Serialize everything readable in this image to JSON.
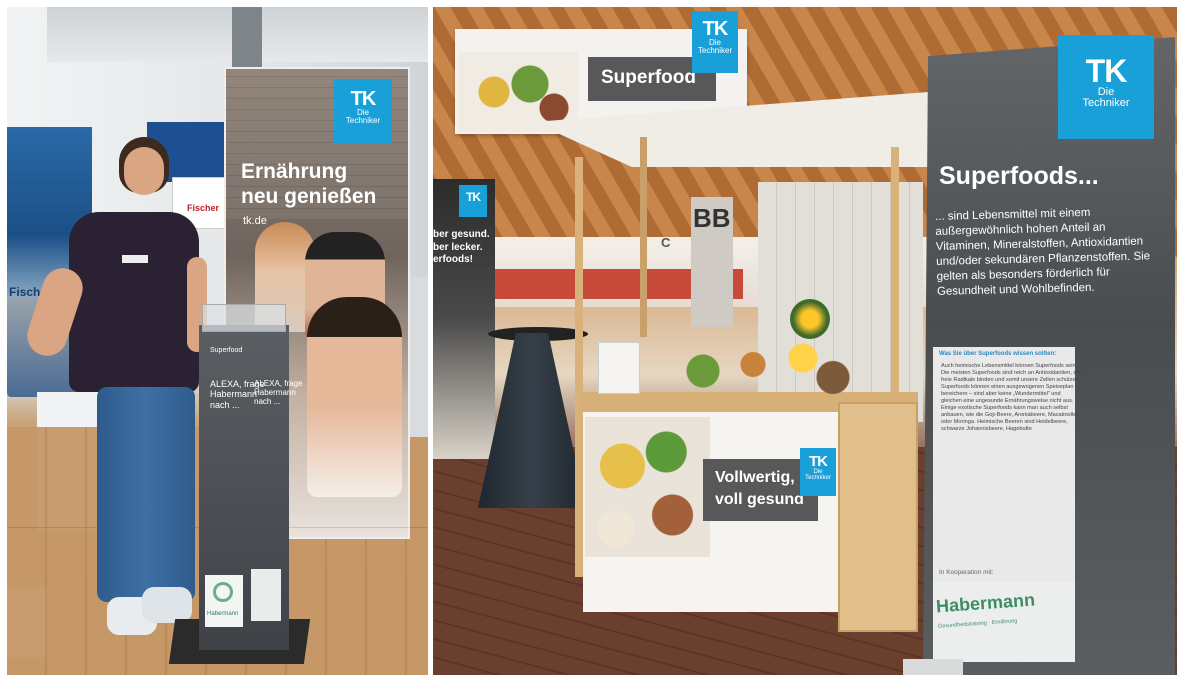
{
  "left_photo": {
    "main_banner": {
      "headline_line1": "Ernährung",
      "headline_line2": "neu genießen",
      "url": "tk.de"
    },
    "tk_logo": {
      "letters": "TK",
      "line1": "Die",
      "line2": "Techniker"
    },
    "side_sign": {
      "text": "Fischer"
    },
    "left_text": {
      "text": "Fisch"
    },
    "pillar": {
      "brand": "Superfood",
      "question": "ALEXA, frage\nHabermann\nnach ...",
      "question_side": "ALEXA, frage\nHabermann\nnach ...",
      "bottom_logo": "Habermann"
    }
  },
  "right_photo": {
    "booth_header": {
      "title": "Superfood"
    },
    "small_banner": {
      "text": "ber gesund.\nber lecker.\nerfoods!"
    },
    "wall_letters": "BB",
    "wall_letter_c": "C",
    "counter_banner": {
      "line1": "Vollwertig,",
      "line2": "voll gesund"
    },
    "rollup": {
      "title": "Superfoods...",
      "body": "... sind Lebensmittel mit einem außergewöhnlich hohen Anteil an Vitaminen, Mineralstoffen, Antioxidantien und/oder sekundären Pflanzenstoffen. Sie gelten als besonders förderlich für Gesundheit und Wohlbefinden.",
      "box_title": "Was Sie über Superfoods wissen sollten:",
      "bullets": [
        "Auch heimische Lebensmittel können Superfoods sein.",
        "Die meisten Superfoods sind reich an Antioxidantien, die freie Radikale binden und somit unsere Zellen schützen.",
        "Superfoods können einen ausgewogenen Speiseplan bereichern – sind aber keine „Wundermittel“ und gleichen eine ungesunde Ernährungsweise nicht aus.",
        "Einige exotische Superfoods kann man auch selbst anbauen, wie die Goji-Beere, Aroniabeere, Macaknollen oder Moringa. Heimische Beeren sind Heidelbeere, schwarze Johannisbeere, Hagebutte"
      ],
      "cooperation": "In Kooperation mit:",
      "partner": "Habermann",
      "partner_sub": "Gesundheitstraining · Ernährung"
    }
  }
}
